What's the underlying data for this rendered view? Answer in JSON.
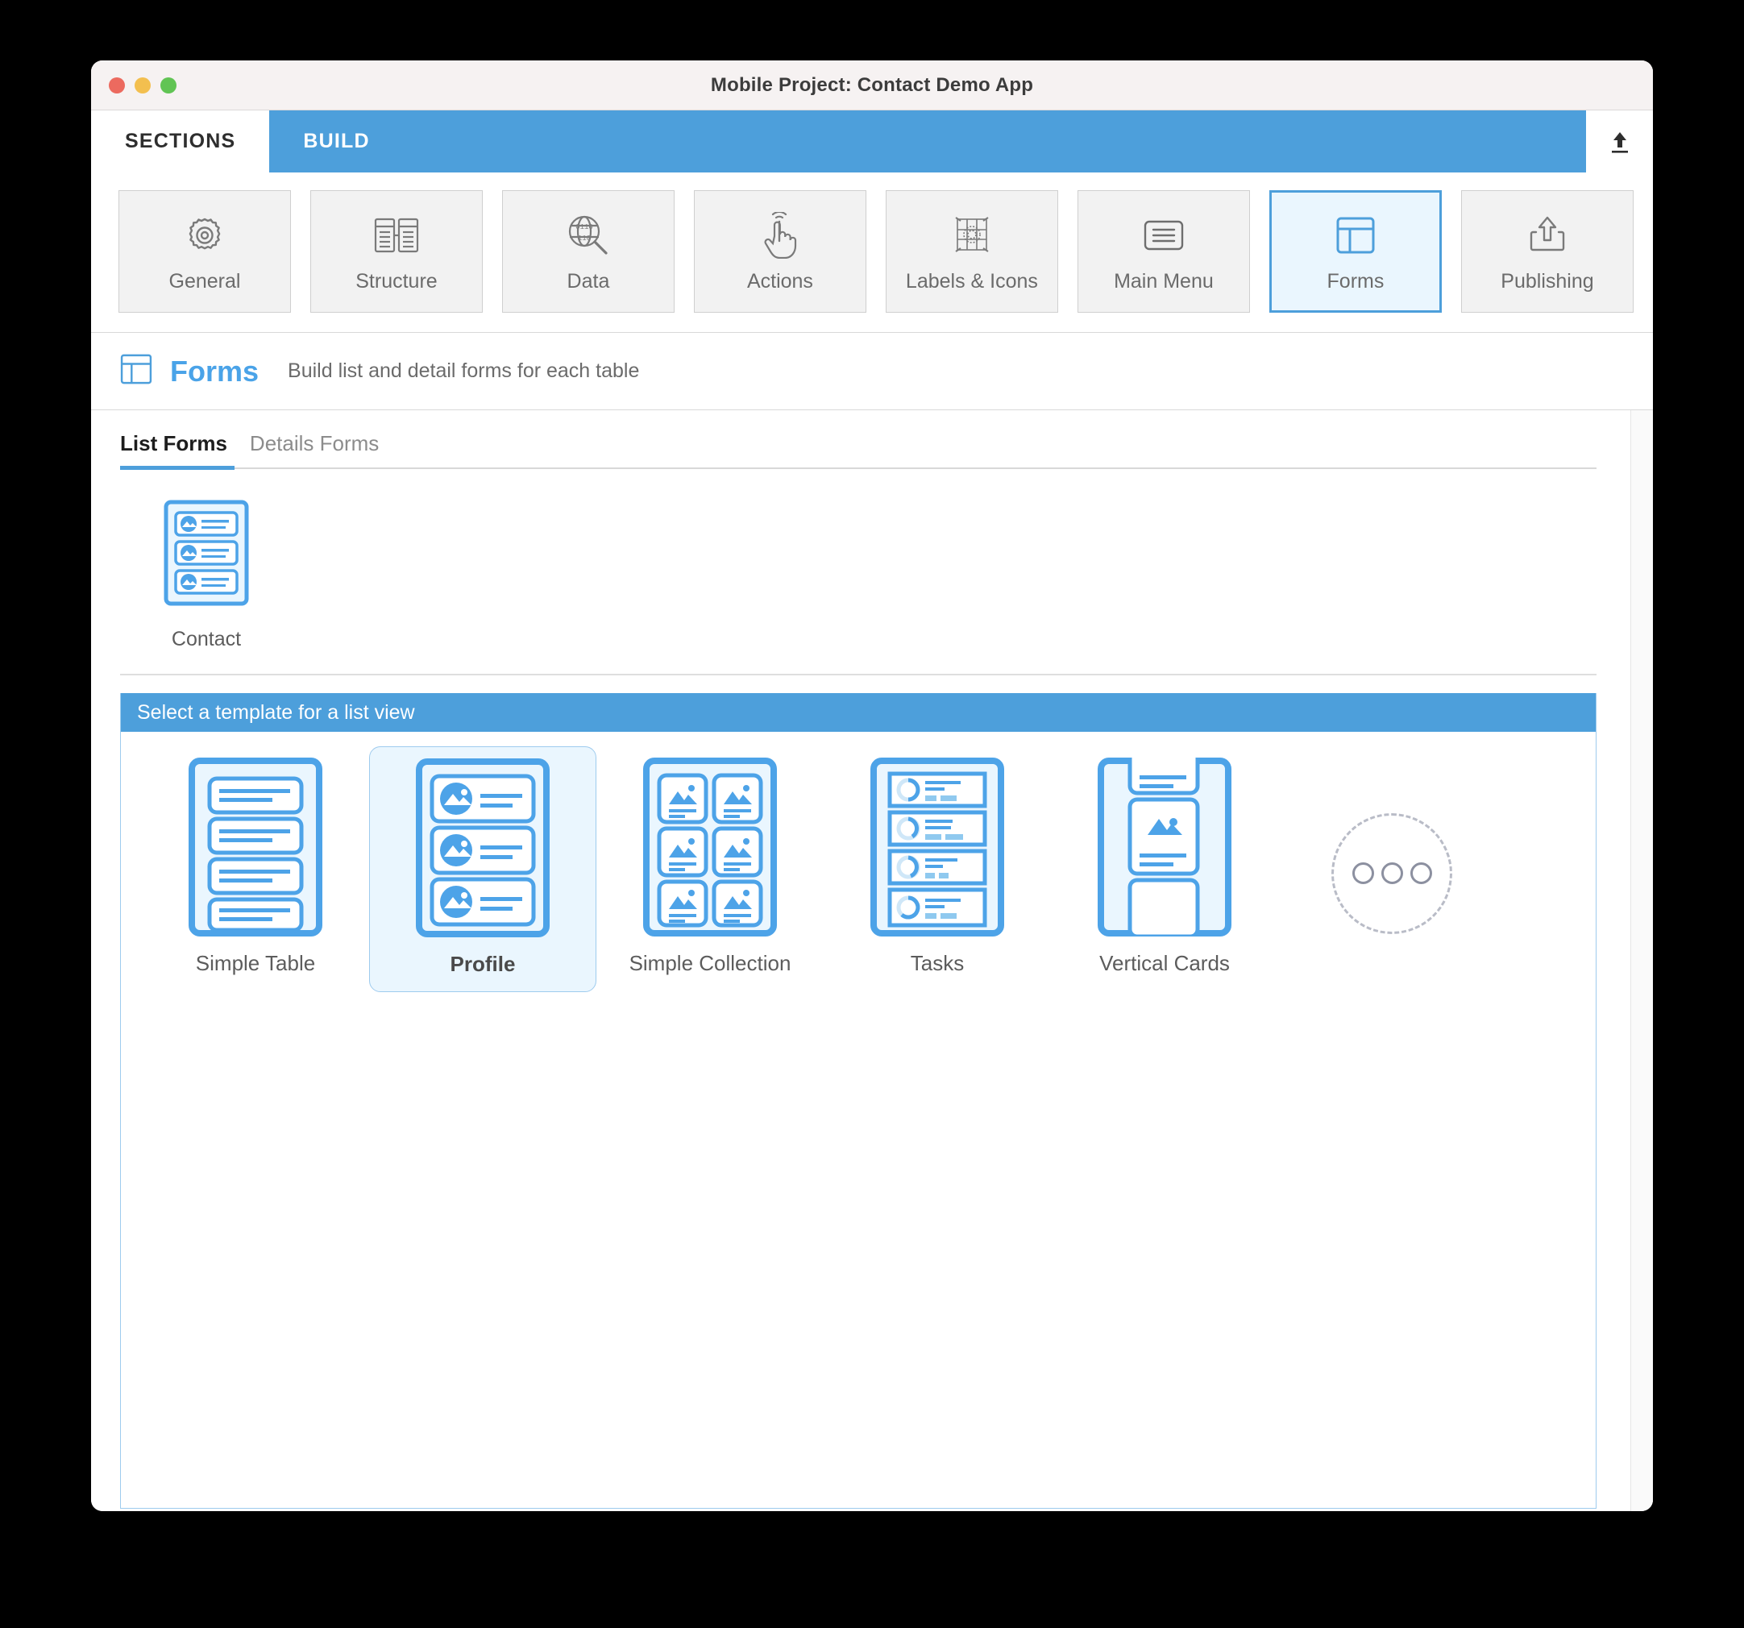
{
  "window": {
    "title": "Mobile Project: Contact Demo App",
    "traffic_lights": [
      "close",
      "minimize",
      "zoom"
    ]
  },
  "top_tabs": [
    {
      "label": "SECTIONS",
      "active": false
    },
    {
      "label": "BUILD",
      "active": true
    }
  ],
  "upload_icon": "upload-icon",
  "toolbar": {
    "items": [
      {
        "label": "General",
        "icon": "gear-icon",
        "selected": false
      },
      {
        "label": "Structure",
        "icon": "tables-icon",
        "selected": false
      },
      {
        "label": "Data",
        "icon": "data-search-icon",
        "selected": false
      },
      {
        "label": "Actions",
        "icon": "tap-hand-icon",
        "selected": false
      },
      {
        "label": "Labels & Icons",
        "icon": "labels-grid-icon",
        "selected": false
      },
      {
        "label": "Main Menu",
        "icon": "menu-list-icon",
        "selected": false
      },
      {
        "label": "Forms",
        "icon": "forms-layout-icon",
        "selected": true
      },
      {
        "label": "Publishing",
        "icon": "export-icon",
        "selected": false
      }
    ]
  },
  "section": {
    "icon": "forms-layout-icon",
    "title": "Forms",
    "subtitle": "Build list and detail forms for each table"
  },
  "sub_tabs": [
    {
      "label": "List Forms",
      "active": true
    },
    {
      "label": "Details Forms",
      "active": false
    }
  ],
  "tables": [
    {
      "label": "Contact",
      "thumbnail": "profile-list-thumbnail"
    }
  ],
  "template_picker": {
    "header": "Select a template for a list view",
    "templates": [
      {
        "label": "Simple Table",
        "art": "simple-table-art",
        "selected": false
      },
      {
        "label": "Profile",
        "art": "profile-art",
        "selected": true
      },
      {
        "label": "Simple Collection",
        "art": "simple-collection-art",
        "selected": false
      },
      {
        "label": "Tasks",
        "art": "tasks-art",
        "selected": false
      },
      {
        "label": "Vertical Cards",
        "art": "vertical-cards-art",
        "selected": false
      }
    ],
    "more_button": {
      "icon": "three-dots-icon",
      "dots": 3
    }
  },
  "colors": {
    "accent_blue": "#4d9fdb",
    "light_blue_fill": "#eaf6fe",
    "art_blue": "#4da3e8",
    "titlebar": "#f6f2f2",
    "toolbar_button": "#f2f2f2",
    "text_gray": "#6b6b6b"
  }
}
